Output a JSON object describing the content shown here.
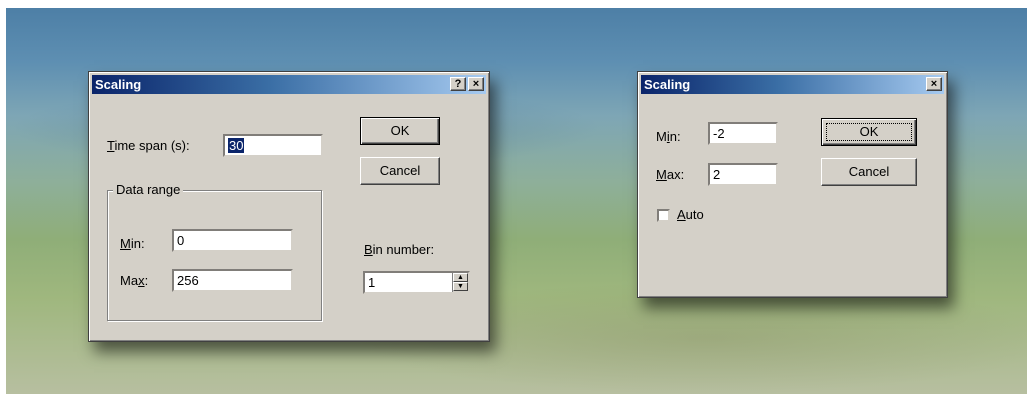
{
  "dialog1": {
    "title": "Scaling",
    "help_button": "?",
    "close_button": "×",
    "time_span_label_u": "T",
    "time_span_label_rest": "ime span (s):",
    "time_span_value": "30",
    "ok_label": "OK",
    "cancel_label": "Cancel",
    "data_range_label": "Data range",
    "min_label_u": "M",
    "min_label_rest": "in:",
    "min_value": "0",
    "max_label_pre": "Ma",
    "max_label_u": "x",
    "max_label_rest": ":",
    "max_value": "256",
    "bin_label_u": "B",
    "bin_label_rest": "in number:",
    "bin_value": "1"
  },
  "dialog2": {
    "title": "Scaling",
    "close_button": "×",
    "min_label_pre": "M",
    "min_label_u": "i",
    "min_label_rest": "n:",
    "min_value": "-2",
    "max_label_u": "M",
    "max_label_rest": "ax:",
    "max_value": "2",
    "ok_label": "OK",
    "cancel_label": "Cancel",
    "auto_label_u": "A",
    "auto_label_rest": "uto",
    "auto_checked": false
  }
}
